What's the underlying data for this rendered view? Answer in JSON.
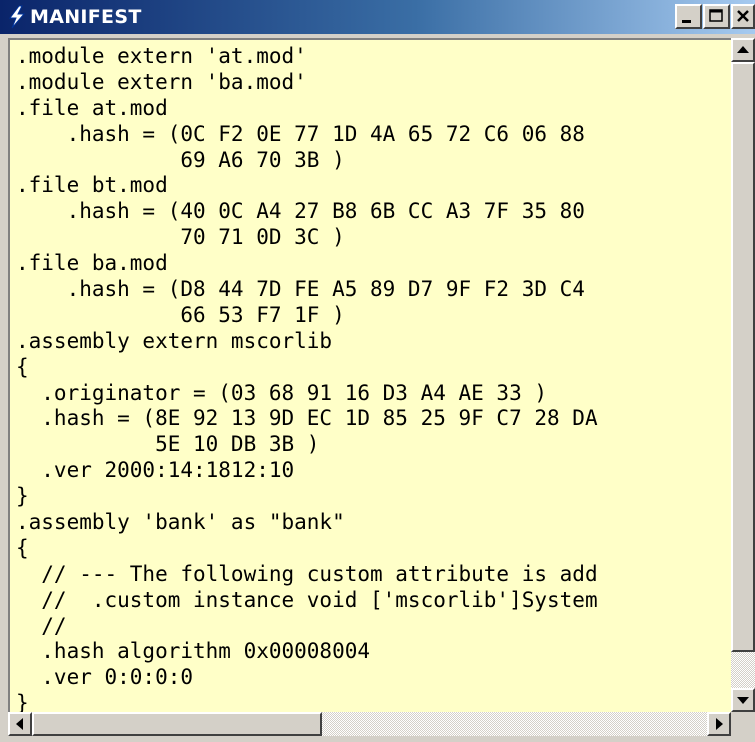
{
  "window": {
    "title": "MANIFEST",
    "icon": "lightning-bolt-icon"
  },
  "colors": {
    "titlebar_start": "#0a246a",
    "titlebar_end": "#a6caf0",
    "editor_background": "#ffffc8",
    "chrome": "#d4d0c8"
  },
  "controls": {
    "minimize_icon": "minimize-icon",
    "maximize_icon": "maximize-icon",
    "close_icon": "close-icon"
  },
  "code_lines": [
    ".module extern 'at.mod'",
    ".module extern 'ba.mod'",
    ".file at.mod",
    "    .hash = (0C F2 0E 77 1D 4A 65 72 C6 06 88",
    "             69 A6 70 3B )",
    ".file bt.mod",
    "    .hash = (40 0C A4 27 B8 6B CC A3 7F 35 80",
    "             70 71 0D 3C )",
    ".file ba.mod",
    "    .hash = (D8 44 7D FE A5 89 D7 9F F2 3D C4",
    "             66 53 F7 1F )",
    ".assembly extern mscorlib",
    "{",
    "  .originator = (03 68 91 16 D3 A4 AE 33 )",
    "  .hash = (8E 92 13 9D EC 1D 85 25 9F C7 28 DA",
    "           5E 10 DB 3B )",
    "  .ver 2000:14:1812:10",
    "}",
    ".assembly 'bank' as \"bank\"",
    "{",
    "  // --- The following custom attribute is add",
    "  //  .custom instance void ['mscorlib']System",
    "  //",
    "  .hash algorithm 0x00008004",
    "  .ver 0:0:0:0",
    "}"
  ],
  "scrollbars": {
    "up_icon": "scroll-up-arrow-icon",
    "down_icon": "scroll-down-arrow-icon",
    "left_icon": "scroll-left-arrow-icon",
    "right_icon": "scroll-right-arrow-icon"
  }
}
